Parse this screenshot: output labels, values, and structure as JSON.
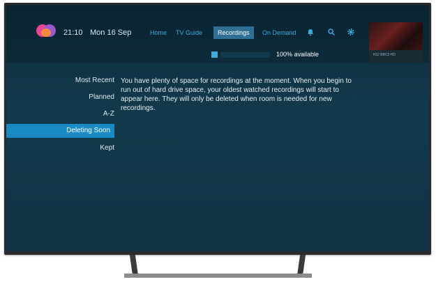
{
  "header": {
    "time": "21:10",
    "date": "Mon 16 Sep",
    "nav": [
      "Home",
      "TV Guide",
      "Recordings",
      "On Demand"
    ],
    "active_nav": "Recordings"
  },
  "storage": {
    "available_text": "100% available",
    "used_fraction": 0.0
  },
  "preview": {
    "channel_label": "K52 BBC2 HD"
  },
  "sidebar": {
    "items": [
      "Most Recent",
      "Planned",
      "A-Z",
      "Deleting Soon",
      "Kept"
    ],
    "active": "Deleting Soon"
  },
  "main": {
    "message": "You have plenty of space for recordings at the moment. When you begin to run out of hard drive space, your oldest watched recordings will start to appear here. They will only be deleted when room is needed for new recordings."
  },
  "colors": {
    "accent": "#1a8ac4",
    "nav_link": "#3fa9d8",
    "background": "#12394c"
  },
  "icons": [
    "virgin-logo-icon",
    "bell-icon",
    "search-icon",
    "gear-icon",
    "storage-icon"
  ]
}
